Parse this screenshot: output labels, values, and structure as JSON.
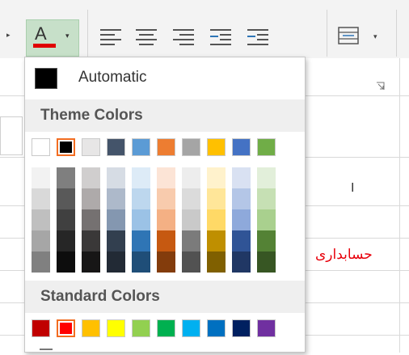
{
  "ribbon": {
    "font_color_glyph": "A",
    "font_color_bar": "#e00000",
    "dropdown_caret": "▾",
    "icons": [
      "align-left-icon",
      "align-center-icon",
      "align-right-icon",
      "decrease-indent-icon",
      "increase-indent-icon",
      "merge-cells-icon",
      "dialog-launcher-icon"
    ]
  },
  "dropdown": {
    "automatic_label": "Automatic",
    "automatic_color": "#000000",
    "theme_header": "Theme Colors",
    "standard_header": "Standard Colors",
    "theme_top_row": [
      "#ffffff",
      "#000000",
      "#e7e6e6",
      "#44546a",
      "#5b9bd5",
      "#ed7d31",
      "#a5a5a5",
      "#ffc000",
      "#4472c4",
      "#70ad47"
    ],
    "theme_top_selected": 1,
    "theme_shades": [
      [
        "#f2f2f2",
        "#d9d9d9",
        "#bfbfbf",
        "#a6a6a6",
        "#808080"
      ],
      [
        "#7f7f7f",
        "#595959",
        "#404040",
        "#262626",
        "#0d0d0d"
      ],
      [
        "#d0cece",
        "#aeaaaa",
        "#757171",
        "#3a3838",
        "#171616"
      ],
      [
        "#d6dce4",
        "#adb9ca",
        "#8497b0",
        "#323f4f",
        "#222a35"
      ],
      [
        "#ddebf7",
        "#bdd7ee",
        "#9bc2e6",
        "#2f75b5",
        "#1f4e78"
      ],
      [
        "#fce4d6",
        "#f8cbad",
        "#f4b084",
        "#c65911",
        "#833c0c"
      ],
      [
        "#ededed",
        "#dbdbdb",
        "#c9c9c9",
        "#7b7b7b",
        "#525252"
      ],
      [
        "#fff2cc",
        "#ffe699",
        "#ffd966",
        "#bf8f00",
        "#806000"
      ],
      [
        "#d9e1f2",
        "#b4c6e7",
        "#8ea9db",
        "#305496",
        "#203764"
      ],
      [
        "#e2efda",
        "#c6e0b4",
        "#a9d08e",
        "#548235",
        "#375623"
      ]
    ],
    "standard_colors": [
      "#c00000",
      "#ff0000",
      "#ffc000",
      "#ffff00",
      "#92d050",
      "#00b050",
      "#00b0f0",
      "#0070c0",
      "#002060",
      "#7030a0"
    ],
    "standard_selected": 1
  },
  "sheet": {
    "column_marker": "I",
    "cell_text": "حسابداری",
    "cell_text_color": "#e8000b"
  }
}
